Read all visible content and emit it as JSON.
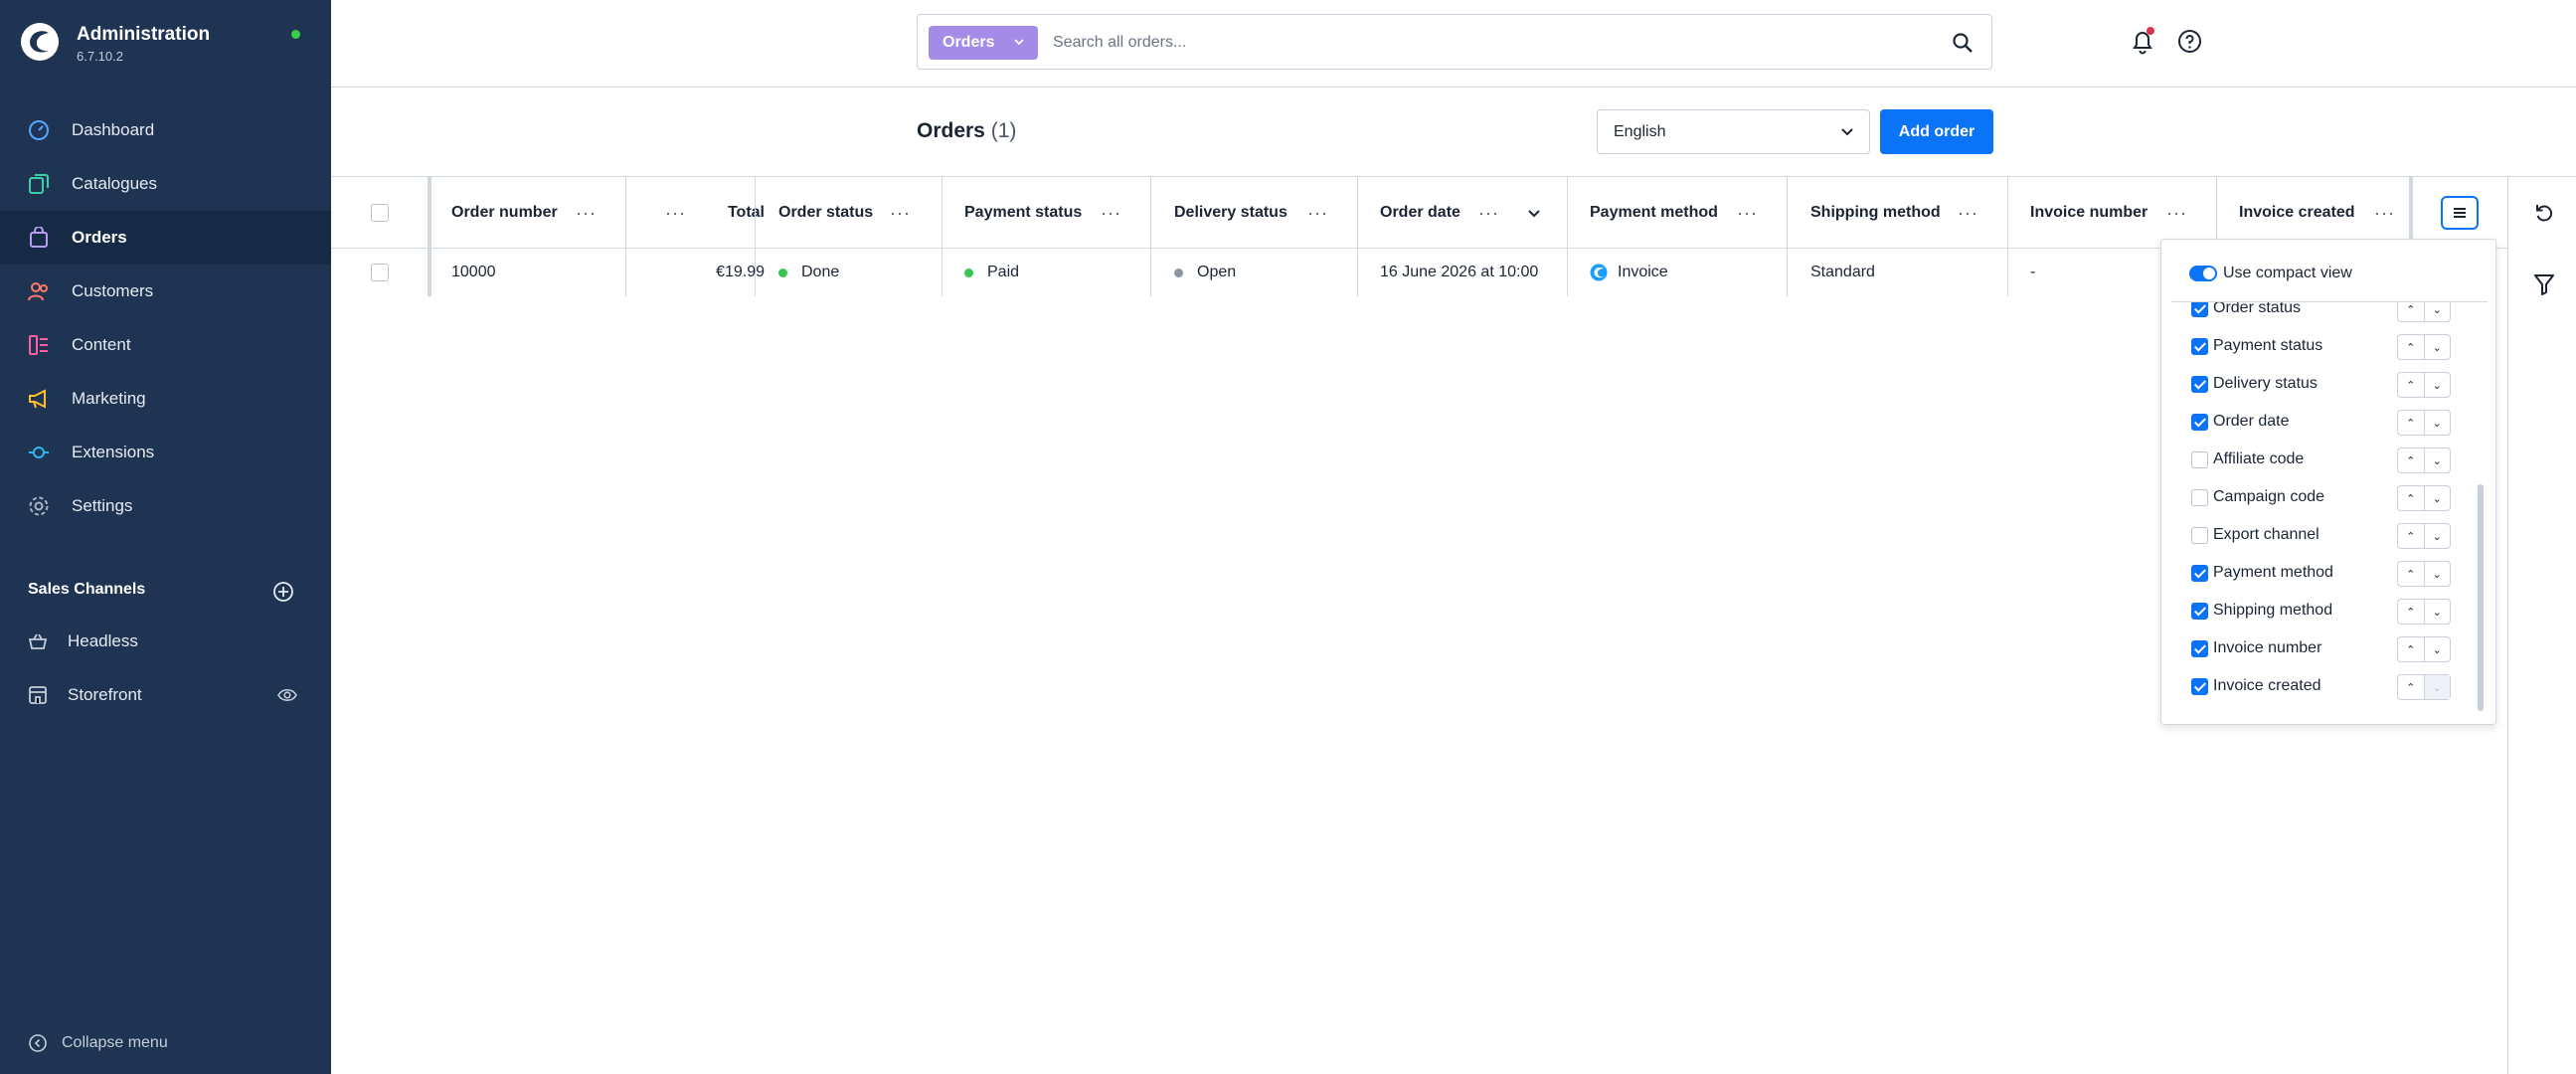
{
  "app": {
    "title": "Administration",
    "version": "6.7.10.2"
  },
  "sidebar": {
    "items": [
      {
        "label": "Dashboard",
        "icon": "gauge-icon"
      },
      {
        "label": "Catalogues",
        "icon": "products-icon"
      },
      {
        "label": "Orders",
        "icon": "bag-icon"
      },
      {
        "label": "Customers",
        "icon": "users-icon"
      },
      {
        "label": "Content",
        "icon": "content-icon"
      },
      {
        "label": "Marketing",
        "icon": "megaphone-icon"
      },
      {
        "label": "Extensions",
        "icon": "plug-icon"
      },
      {
        "label": "Settings",
        "icon": "gear-icon"
      }
    ],
    "active": "Orders",
    "sales_channels_heading": "Sales Channels",
    "sales_channels": [
      {
        "label": "Headless",
        "icon": "basket-icon"
      },
      {
        "label": "Storefront",
        "icon": "storefront-icon"
      }
    ],
    "collapse_label": "Collapse menu"
  },
  "search": {
    "type_label": "Orders",
    "placeholder": "Search all orders..."
  },
  "page": {
    "title": "Orders",
    "count": "(1)",
    "language": "English",
    "add_button": "Add order"
  },
  "grid": {
    "columns": [
      "Order number",
      "Total",
      "Order status",
      "Payment status",
      "Delivery status",
      "Order date",
      "Payment method",
      "Shipping method",
      "Invoice number",
      "Invoice created"
    ],
    "rows": [
      {
        "order_number": "10000",
        "total": "€19.99",
        "order_status": "Done",
        "payment_status": "Paid",
        "delivery_status": "Open",
        "order_date": "16 June 2026 at 10:00",
        "payment_method": "Invoice",
        "shipping_method": "Standard",
        "invoice_number": "-"
      }
    ]
  },
  "column_settings": {
    "compact_label": "Use compact view",
    "compact_on": true,
    "items": [
      {
        "label": "Order status",
        "checked": true
      },
      {
        "label": "Payment status",
        "checked": true
      },
      {
        "label": "Delivery status",
        "checked": true
      },
      {
        "label": "Order date",
        "checked": true
      },
      {
        "label": "Affiliate code",
        "checked": false
      },
      {
        "label": "Campaign code",
        "checked": false
      },
      {
        "label": "Export channel",
        "checked": false
      },
      {
        "label": "Payment method",
        "checked": true
      },
      {
        "label": "Shipping method",
        "checked": true
      },
      {
        "label": "Invoice number",
        "checked": true
      },
      {
        "label": "Invoice created",
        "checked": true
      }
    ]
  },
  "colors": {
    "sidebar_bg": "#1f3352",
    "accent": "#0b73f5",
    "search_type_bg": "#a38ce8",
    "status_green": "#37c553",
    "status_grey": "#8a95a5"
  }
}
